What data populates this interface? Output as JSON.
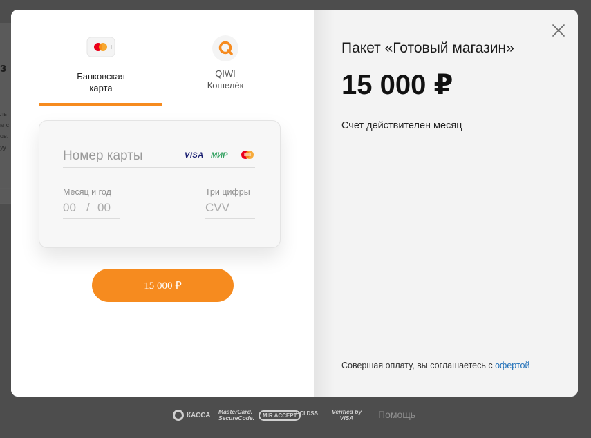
{
  "background": {
    "fragment_big": "з",
    "fragment_lines": [
      "ль",
      "м с",
      "ов.",
      "уу"
    ]
  },
  "tabs": {
    "card": {
      "label_line1": "Банковская",
      "label_line2": "карта",
      "icon": "mastercard-icon"
    },
    "qiwi": {
      "label_line1": "QIWI",
      "label_line2": "Кошелёк",
      "icon": "qiwi-icon"
    },
    "active": "card"
  },
  "card_form": {
    "number_placeholder": "Номер карты",
    "brands": {
      "visa": "VISA",
      "mir": "МИР",
      "mastercard": "mastercard-logo"
    },
    "expiry_label": "Месяц и год",
    "expiry_month_placeholder": "00",
    "expiry_separator": "/",
    "expiry_year_placeholder": "00",
    "cvv_label": "Три цифры",
    "cvv_placeholder": "CVV"
  },
  "pay_button": {
    "label": "15 000 ₽"
  },
  "product": {
    "title": "Пакет «Готовый магазин»",
    "price": "15 000 ₽",
    "note": "Счет действителен месяц"
  },
  "terms": {
    "text": "Совершая оплату, вы соглашаетесь с ",
    "link": "офертой"
  },
  "footer": {
    "kassa": "КАССА",
    "mastercard_line1": "MasterCard.",
    "mastercard_line2": "SecureCode.",
    "mir_accept": "MIR ACCEPT",
    "pci": "PCI DSS",
    "visa_line1": "Verified by",
    "visa_line2": "VISA",
    "help": "Помощь"
  },
  "colors": {
    "accent": "#f68b1f",
    "link": "#1e6fb8",
    "right_pane": "#f3f3f3"
  }
}
